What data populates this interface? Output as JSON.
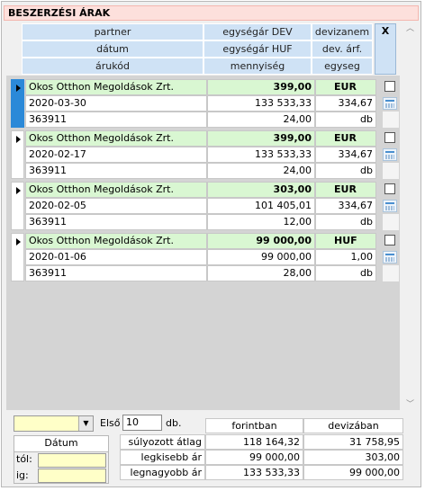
{
  "title": "BESZERZÉSI ÁRAK",
  "headers": {
    "partner": "partner",
    "datum": "dátum",
    "arukod": "árukód",
    "egysegar_dev": "egységár DEV",
    "egysegar_huf": "egységár HUF",
    "mennyiseg": "mennyiség",
    "devizanem": "devizanem",
    "dev_arf": "dev. árf.",
    "egyseg": "egyseg",
    "x": "X"
  },
  "records": [
    {
      "partner": "Okos Otthon Megoldások Zrt.",
      "egysegar_dev": "399,00",
      "devizanem": "EUR",
      "datum": "2020-03-30",
      "egysegar_huf": "133 533,33",
      "arf": "334,67",
      "arukod": "363911",
      "mennyiseg": "24,00",
      "egyseg": "db",
      "checked": false
    },
    {
      "partner": "Okos Otthon Megoldások Zrt.",
      "egysegar_dev": "399,00",
      "devizanem": "EUR",
      "datum": "2020-02-17",
      "egysegar_huf": "133 533,33",
      "arf": "334,67",
      "arukod": "363911",
      "mennyiseg": "24,00",
      "egyseg": "db",
      "checked": false
    },
    {
      "partner": "Okos Otthon Megoldások Zrt.",
      "egysegar_dev": "303,00",
      "devizanem": "EUR",
      "datum": "2020-02-05",
      "egysegar_huf": "101 405,01",
      "arf": "334,67",
      "arukod": "363911",
      "mennyiseg": "12,00",
      "egyseg": "db",
      "checked": false
    },
    {
      "partner": "Okos Otthon Megoldások Zrt.",
      "egysegar_dev": "99 000,00",
      "devizanem": "HUF",
      "datum": "2020-01-06",
      "egysegar_huf": "99 000,00",
      "arf": "1,00",
      "arukod": "363911",
      "mennyiseg": "28,00",
      "egyseg": "db",
      "checked": false
    }
  ],
  "footer": {
    "combo_value": "",
    "elso_label": "Első",
    "elso_value": "10",
    "db_label": "db.",
    "datum_label": "Dátum",
    "tol_label": "tól:",
    "ig_label": "ig:",
    "tol_value": "",
    "ig_value": "",
    "col_forint": "forintban",
    "col_deviza": "devizában",
    "stats": [
      {
        "label": "súlyozott átlag",
        "forint": "118 164,32",
        "deviza": "31 758,95"
      },
      {
        "label": "legkisebb ár",
        "forint": "99 000,00",
        "deviza": "303,00"
      },
      {
        "label": "legnagyobb ár",
        "forint": "133 533,33",
        "deviza": "99 000,00"
      }
    ]
  }
}
